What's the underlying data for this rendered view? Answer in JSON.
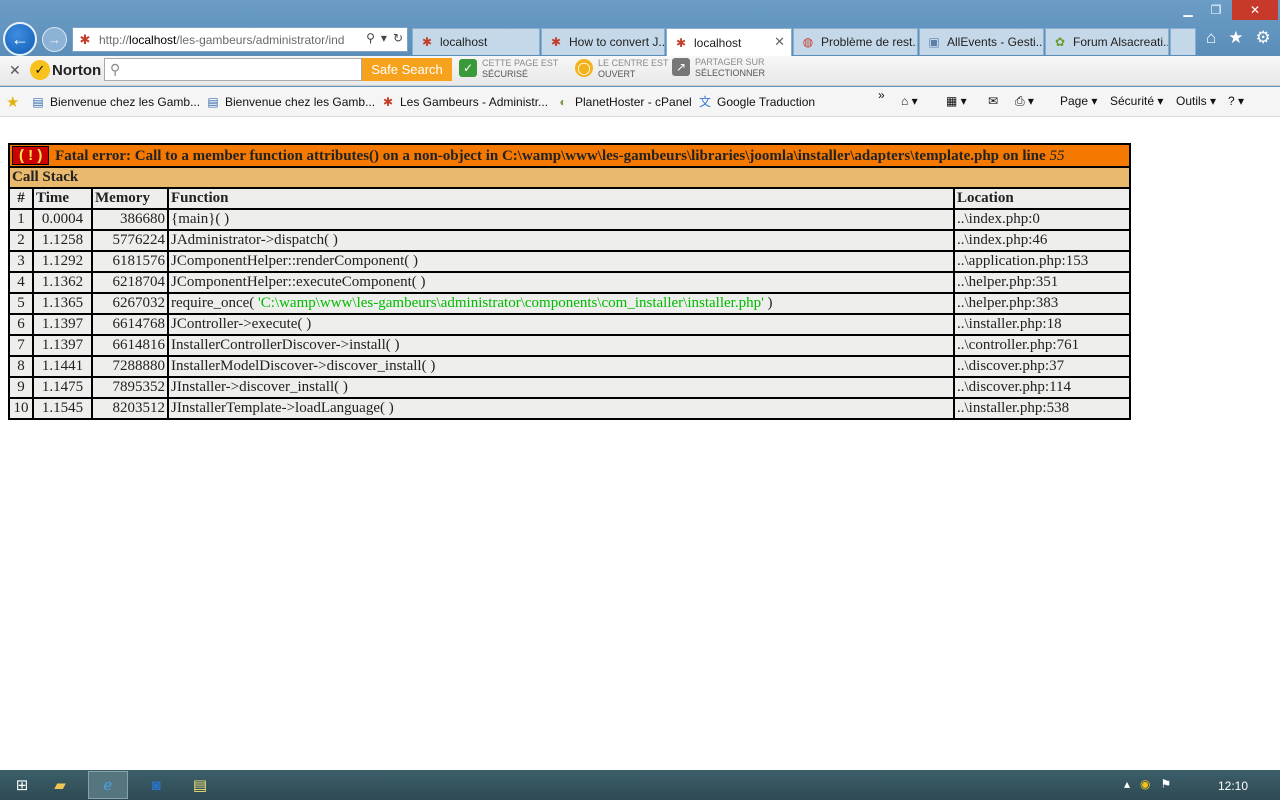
{
  "browser": {
    "address": {
      "scheme": "http://",
      "host": "localhost",
      "path": "/les-gambeurs/administrator/ind"
    },
    "tabs": [
      {
        "label": "localhost",
        "active": false
      },
      {
        "label": "How to convert J...",
        "active": false
      },
      {
        "label": "localhost",
        "active": true
      },
      {
        "label": "Problème de rest...",
        "active": false
      },
      {
        "label": "AllEvents - Gesti...",
        "active": false
      },
      {
        "label": "Forum Alsacreati...",
        "active": false
      }
    ],
    "tab_close_glyph": "✕"
  },
  "norton": {
    "brand": "Norton",
    "search_placeholder": "",
    "search_button": "Safe Search",
    "status": [
      {
        "line1": "CETTE PAGE EST",
        "line2": "SÉCURISÉ"
      },
      {
        "line1": "LE CENTRE EST",
        "line2": "OUVERT"
      },
      {
        "line1": "PARTAGER SUR",
        "line2": "SÉLECTIONNER"
      }
    ]
  },
  "favorites": [
    "Bienvenue chez les Gamb...",
    "Bienvenue chez les Gamb...",
    "Les Gambeurs - Administr...",
    "PlanetHoster - cPanel",
    "Google Traduction"
  ],
  "commands": {
    "page": "Page ▾",
    "security": "Sécurité ▾",
    "tools": "Outils ▾",
    "help": "? ▾"
  },
  "error": {
    "bang": "( ! )",
    "message": "Fatal error: Call to a member function attributes() on a non-object in C:\\wamp\\www\\les-gambeurs\\libraries\\joomla\\installer\\adapters\\template.php on line",
    "line": "55",
    "callstack_title": "Call Stack",
    "headers": [
      "#",
      "Time",
      "Memory",
      "Function",
      "Location"
    ],
    "rows": [
      {
        "n": "1",
        "time": "0.0004",
        "memory": "386680",
        "func": "{main}( )",
        "loc": "..\\index.php:0"
      },
      {
        "n": "2",
        "time": "1.1258",
        "memory": "5776224",
        "func": "JAdministrator->dispatch( )",
        "loc": "..\\index.php:46"
      },
      {
        "n": "3",
        "time": "1.1292",
        "memory": "6181576",
        "func": "JComponentHelper::renderComponent( )",
        "loc": "..\\application.php:153"
      },
      {
        "n": "4",
        "time": "1.1362",
        "memory": "6218704",
        "func": "JComponentHelper::executeComponent( )",
        "loc": "..\\helper.php:351"
      },
      {
        "n": "5",
        "time": "1.1365",
        "memory": "6267032",
        "func": "require_once(",
        "func_str": "'C:\\wamp\\www\\les-gambeurs\\administrator\\components\\com_installer\\installer.php'",
        "func_end": " )",
        "loc": "..\\helper.php:383"
      },
      {
        "n": "6",
        "time": "1.1397",
        "memory": "6614768",
        "func": "JController->execute( )",
        "loc": "..\\installer.php:18"
      },
      {
        "n": "7",
        "time": "1.1397",
        "memory": "6614816",
        "func": "InstallerControllerDiscover->install( )",
        "loc": "..\\controller.php:761"
      },
      {
        "n": "8",
        "time": "1.1441",
        "memory": "7288880",
        "func": "InstallerModelDiscover->discover_install( )",
        "loc": "..\\discover.php:37"
      },
      {
        "n": "9",
        "time": "1.1475",
        "memory": "7895352",
        "func": "JInstaller->discover_install( )",
        "loc": "..\\discover.php:114"
      },
      {
        "n": "10",
        "time": "1.1545",
        "memory": "8203512",
        "func": "JInstallerTemplate->loadLanguage( )",
        "loc": "..\\installer.php:538"
      }
    ]
  },
  "taskbar": {
    "clock": "12:10"
  }
}
